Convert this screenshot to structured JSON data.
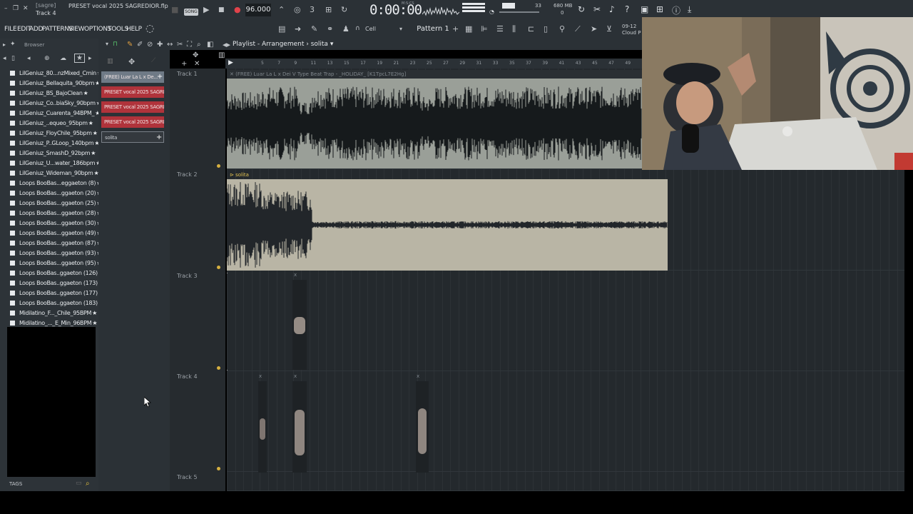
{
  "titlebar": {
    "app_name": "[sagre]",
    "project_name": "PRESET vocal 2025 SAGREDIOR.flp",
    "focused_item": "Track 4",
    "song_mode": "SONG",
    "tempo": "96.000",
    "time_display": "0:00:00",
    "time_label": "M:S:CS",
    "volume_value": "33",
    "memory": "680 MB",
    "cpu_value": "0"
  },
  "menu": {
    "items": [
      "FILE",
      "EDIT",
      "ADD",
      "PATTERNS",
      "VIEW",
      "OPTIONS",
      "TOOLS",
      "HELP"
    ],
    "snap_mode": "Cell",
    "pattern": "Pattern 1",
    "cloud_date": "09-12",
    "cloud_label": "Cloud P"
  },
  "browser": {
    "title": "Browser",
    "tags_label": "TAGS",
    "files": [
      "LilGeniuz_80...nzMixed_Cmin",
      "LilGeniuz_Bellaquita_90bpm",
      "LilGeniuz_BS_BajoClean",
      "LilGeniuz_Co..biaSky_90bpm",
      "LilGeniuz_Cuarenta_94BPM_",
      "LilGeniuz_..equeo_95bpm",
      "LilGeniuz_FloyChile_95bpm",
      "LilGeniuz_P..GLoop_140bpm",
      "LilGeniuz_SmashD_92bpm",
      "LilGeniuz_U...water_186bpm",
      "LilGeniuz_Wideman_90bpm",
      "Loops BooBas...eggaeton (8)",
      "Loops BooBas...ggaeton (20)",
      "Loops BooBas...ggaeton (25)",
      "Loops BooBas...ggaeton (28)",
      "Loops BooBas...ggaeton (30)",
      "Loops BooBas...ggaeton (49)",
      "Loops BooBas...ggaeton (87)",
      "Loops BooBas...ggaeton (93)",
      "Loops BooBas...ggaeton (95)",
      "Loops BooBas..ggaeton (126)",
      "Loops BooBas..ggaeton (173)",
      "Loops BooBas..ggaeton (177)",
      "Loops BooBas..ggaeton (183)",
      "Midilatino_F..._Chile_95BPM",
      "Midilatino_..._E_Min_96BPM"
    ]
  },
  "channels": {
    "items": [
      {
        "label": "(FREE) Luar La L x De...",
        "color": "#6f7a86"
      },
      {
        "label": "PRESET vocal 2025 SAGRE...",
        "color": "#b0333b"
      },
      {
        "label": "PRESET vocal 2025 SAGRE...",
        "color": "#b0333b"
      },
      {
        "label": "PRESET vocal 2025 SAGRE...",
        "color": "#b0333b"
      },
      {
        "label": "solita",
        "color": "#34393e"
      }
    ]
  },
  "playlist": {
    "title": "Playlist - Arrangement",
    "current_pattern": "solita",
    "ruler": [
      "5",
      "7",
      "9",
      "11",
      "13",
      "15",
      "17",
      "19",
      "21",
      "23",
      "25",
      "27",
      "29",
      "31",
      "33",
      "35",
      "37",
      "39",
      "41",
      "43",
      "45",
      "47",
      "49"
    ],
    "tracks": [
      "Track 1",
      "Track 2",
      "Track 3",
      "Track 4",
      "Track 5"
    ],
    "clip1_title": "(FREE) Luar La L x Dei V Type Beat Trap - _HOLIDAY_ [K1TpcL7E2Hg]",
    "clip2_title": "solita",
    "clip_x_marker": "x"
  }
}
